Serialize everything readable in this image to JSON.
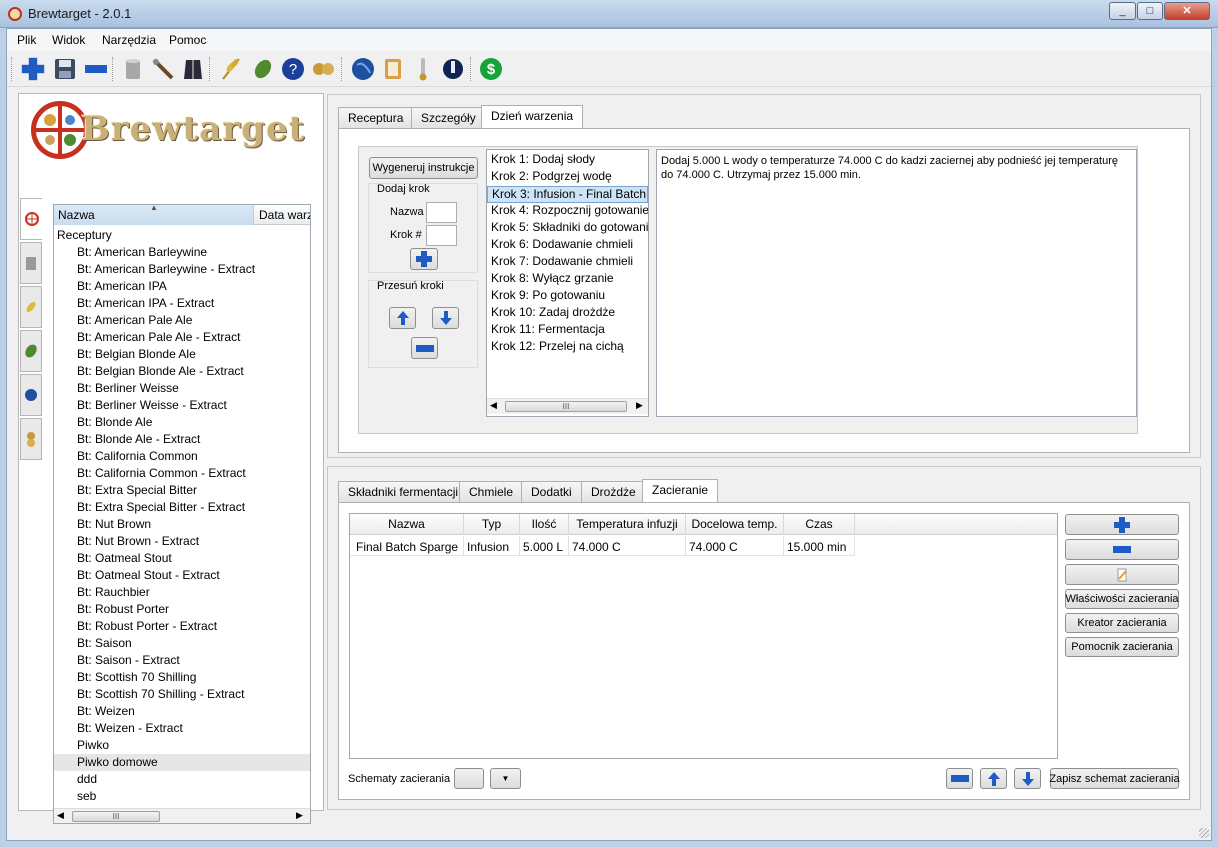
{
  "window": {
    "title": "Brewtarget - 2.0.1",
    "min": "_",
    "max": "□",
    "close": "✕"
  },
  "menu": [
    "Plik",
    "Widok",
    "Narzędzia",
    "Pomoc"
  ],
  "toolbar": {
    "icons": [
      "new-recipe",
      "save",
      "remove",
      "clean-equipment",
      "tools",
      "clothing",
      "fermentables",
      "hops",
      "help",
      "yeast",
      "globe",
      "notes",
      "thermometer",
      "refractometer",
      "pricing"
    ]
  },
  "logo": {
    "text": "Brewtarget"
  },
  "tree": {
    "headers": {
      "name": "Nazwa",
      "date": "Data warz"
    },
    "root": "Receptury",
    "items": [
      "Bt: American Barleywine",
      "Bt: American Barleywine - Extract",
      "Bt: American IPA",
      "Bt: American IPA - Extract",
      "Bt: American Pale Ale",
      "Bt: American Pale Ale - Extract",
      "Bt: Belgian Blonde Ale",
      "Bt: Belgian Blonde Ale - Extract",
      "Bt: Berliner Weisse",
      "Bt: Berliner Weisse - Extract",
      "Bt: Blonde Ale",
      "Bt: Blonde Ale - Extract",
      "Bt: California Common",
      "Bt: California Common - Extract",
      "Bt: Extra Special Bitter",
      "Bt: Extra Special Bitter - Extract",
      "Bt: Nut Brown",
      "Bt: Nut Brown - Extract",
      "Bt: Oatmeal Stout",
      "Bt: Oatmeal Stout - Extract",
      "Bt: Rauchbier",
      "Bt: Robust Porter",
      "Bt: Robust Porter - Extract",
      "Bt: Saison",
      "Bt: Saison - Extract",
      "Bt: Scottish 70 Shilling",
      "Bt: Scottish 70 Shilling - Extract",
      "Bt: Weizen",
      "Bt: Weizen - Extract",
      "Piwko",
      "Piwko domowe",
      "ddd",
      "seb"
    ],
    "selected": "Piwko domowe",
    "scroll_thumb": "III"
  },
  "top_tabs": [
    "Receptura",
    "Szczegóły",
    "Dzień warzenia"
  ],
  "top_active": "Dzień warzenia",
  "brewday": {
    "generate_button": "Wygeneruj instrukcje",
    "add_step_title": "Dodaj krok",
    "name_label": "Nazwa",
    "step_label": "Krok #",
    "move_title": "Przesuń kroki",
    "steps": [
      "Krok 1: Dodaj słody",
      "Krok 2: Podgrzej wodę",
      "Krok 3: Infusion - Final Batch",
      "Krok 4: Rozpocznij gotowanie",
      "Krok 5: Składniki do gotowani",
      "Krok 6: Dodawanie chmieli",
      "Krok 7: Dodawanie chmieli",
      "Krok 8: Wyłącz grzanie",
      "Krok 9: Po gotowaniu",
      "Krok 10: Zadaj drożdże",
      "Krok 11: Fermentacja",
      "Krok 12: Przelej na cichą"
    ],
    "selected_step": "Krok 3: Infusion - Final Batch",
    "step_text": "Dodaj 5.000 L wody o temperaturze 74.000 C do kadzi zaciernej aby podnieść jej temperaturę do 74.000 C. Utrzymaj przez 15.000 min.",
    "scroll_thumb": "III"
  },
  "bottom_tabs": [
    "Składniki fermentacji",
    "Chmiele",
    "Dodatki",
    "Drożdże",
    "Zacieranie"
  ],
  "bottom_active": "Zacieranie",
  "mash": {
    "headers": [
      "Nazwa",
      "Typ",
      "Ilość",
      "Temperatura infuzji",
      "Docelowa temp.",
      "Czas"
    ],
    "rows": [
      [
        "Final Batch Sparge",
        "Infusion",
        "5.000 L",
        "74.000 C",
        "74.000 C",
        "15.000 min"
      ]
    ],
    "props_button": "Właściwości zacierania",
    "wizard_button": "Kreator zacierania",
    "helper_button": "Pomocnik zacierania",
    "schemes_label": "Schematy zacierania",
    "save_scheme_button": "Zapisz schemat zacierania"
  },
  "colors": {
    "accent_blue": "#1e5bc4",
    "logo_red": "#c8301e",
    "selection": "#cde3f7"
  }
}
